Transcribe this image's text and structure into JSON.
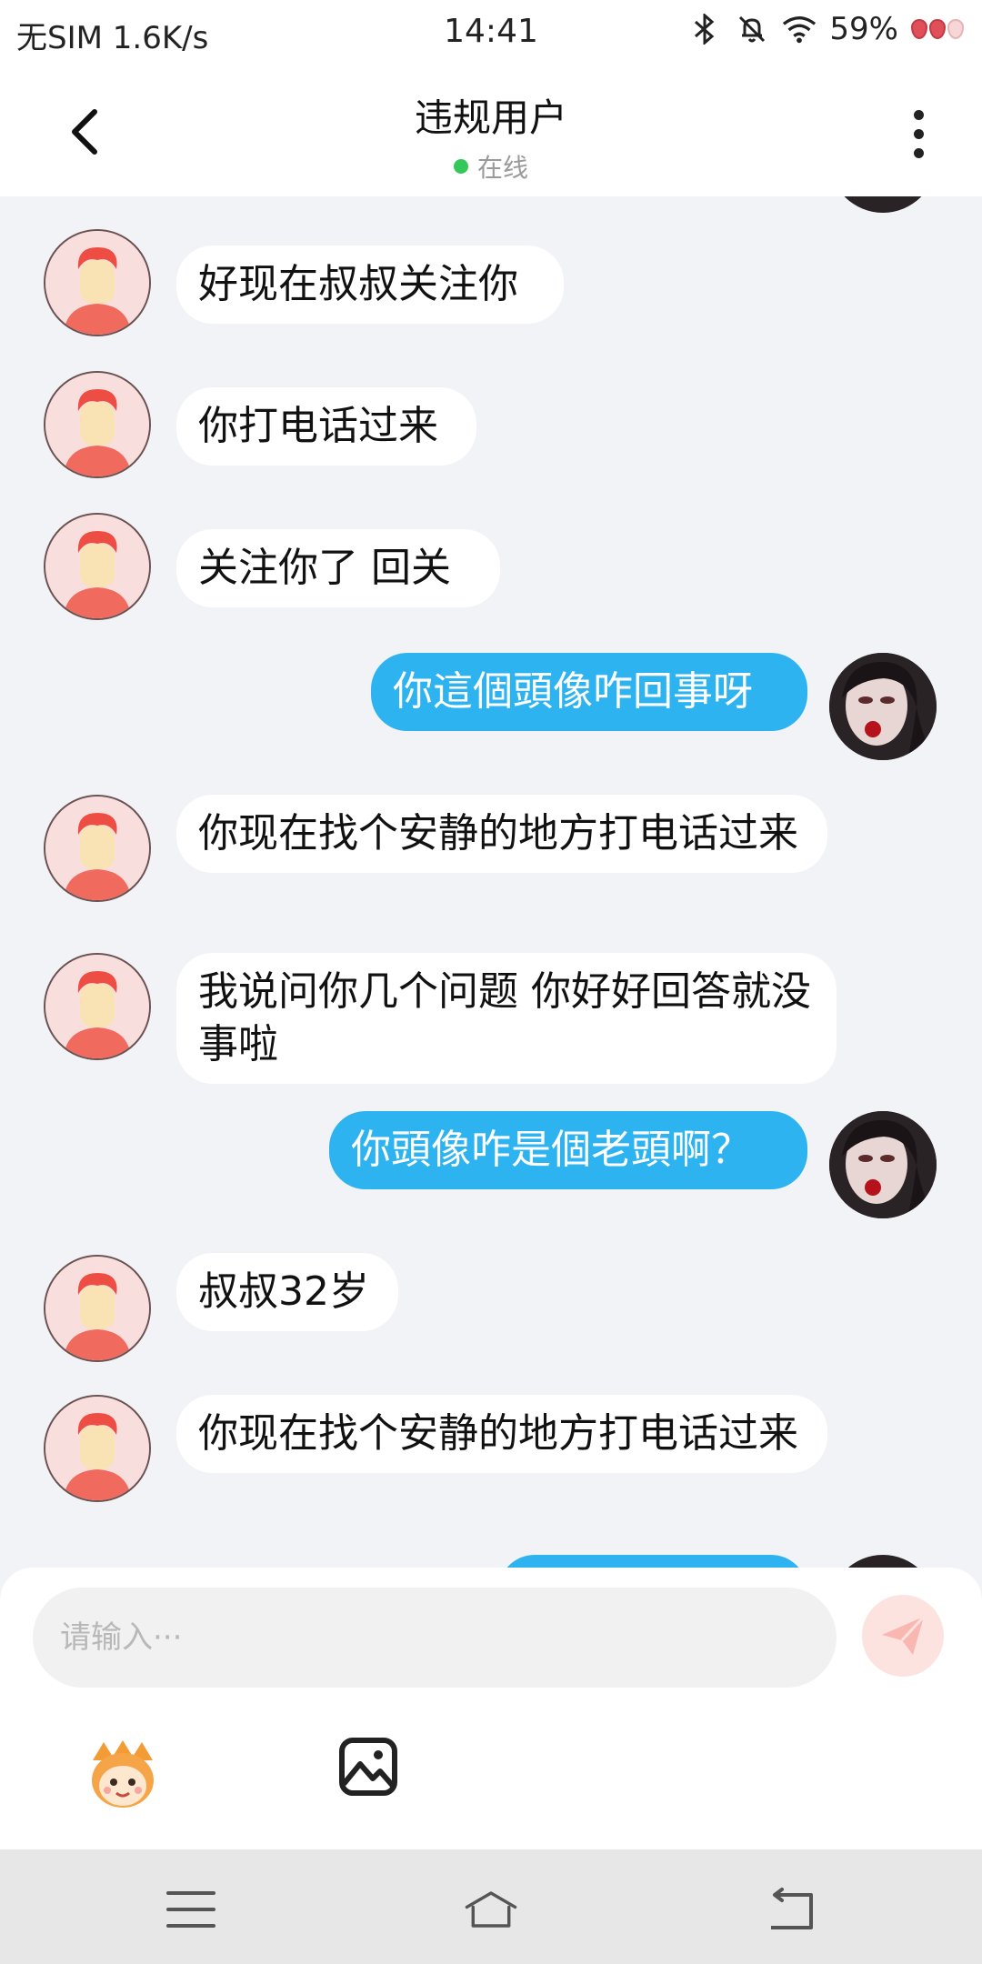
{
  "status_bar": {
    "carrier": "无SIM",
    "speed": "1.6K/s",
    "time": "14:41",
    "battery": "59%",
    "icons": [
      "bluetooth-icon",
      "mute-bell-icon",
      "wifi-icon",
      "strawberry-icon"
    ]
  },
  "header": {
    "title": "违规用户",
    "status": "在线",
    "status_color": "#34c759"
  },
  "messages": [
    {
      "side": "in",
      "text": "好现在叔叔关注你"
    },
    {
      "side": "in",
      "text": "你打电话过来"
    },
    {
      "side": "in",
      "text": "关注你了 回关"
    },
    {
      "side": "out",
      "text": "你這個頭像咋回事呀"
    },
    {
      "side": "in",
      "text": "你现在找个安静的地方打电话过来"
    },
    {
      "side": "in",
      "text": "我说问你几个问题 你好好回答就没事啦"
    },
    {
      "side": "out",
      "text": "你頭像咋是個老頭啊？"
    },
    {
      "side": "in",
      "text": "叔叔32岁"
    },
    {
      "side": "in",
      "text": "你现在找个安静的地方打电话过来"
    },
    {
      "side": "out",
      "text": ""
    }
  ],
  "composer": {
    "placeholder": "请输入···",
    "send_icon": "send-icon",
    "tools": [
      "emoji-mascot-icon",
      "image-icon"
    ]
  },
  "colors": {
    "outgoing_bubble": "#2db3f0",
    "incoming_bubble": "#ffffff",
    "background": "#f2f3f7"
  },
  "nav": [
    "menu-icon",
    "home-icon",
    "back-icon"
  ]
}
